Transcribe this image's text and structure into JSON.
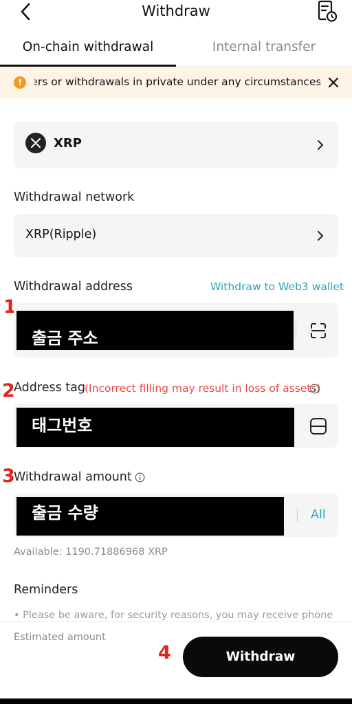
{
  "header": {
    "title": "Withdraw",
    "back_icon": "chevron-left-icon",
    "history_icon": "document-clock-icon"
  },
  "tabs": [
    {
      "label": "On-chain withdrawal",
      "active": true
    },
    {
      "label": "Internal transfer",
      "active": false
    }
  ],
  "notice": {
    "text": "transfers or withdrawals in private under any circumstances. P",
    "icon": "warning-icon",
    "close_icon": "close-icon"
  },
  "coin": {
    "name": "XRP",
    "logo": "xrp-logo-icon"
  },
  "network": {
    "label": "Withdrawal network",
    "value": "XRP(Ripple)"
  },
  "address": {
    "label": "Withdrawal address",
    "web3_link": "Withdraw to Web3 wallet",
    "redacted_text": "출금 주소",
    "scan_icon": "scan-icon"
  },
  "tag": {
    "label": "Address tag",
    "warning": "(Incorrect filling may result in loss of assets)",
    "redacted_text": "태그번호",
    "icon": "scan-alt-icon"
  },
  "amount": {
    "label": "Withdrawal amount",
    "redacted_text": "출금 수량",
    "all_label": "All",
    "available": "Available: 1190.71886968 XRP"
  },
  "reminders": {
    "label": "Reminders",
    "first": "• Please be aware, for security reasons, you may receive phone"
  },
  "annotations": [
    "1",
    "2",
    "3",
    "4"
  ],
  "footer": {
    "estimated_label": "Estimated amount",
    "withdraw_label": "Withdraw"
  },
  "colors": {
    "accent": "#2aa3b8",
    "warning": "#e8473f",
    "notice_bg": "#fdf3e6",
    "notice_icon": "#f29a1f",
    "annotation_red": "#e0241b",
    "primary_button": "#0a0a0a"
  }
}
